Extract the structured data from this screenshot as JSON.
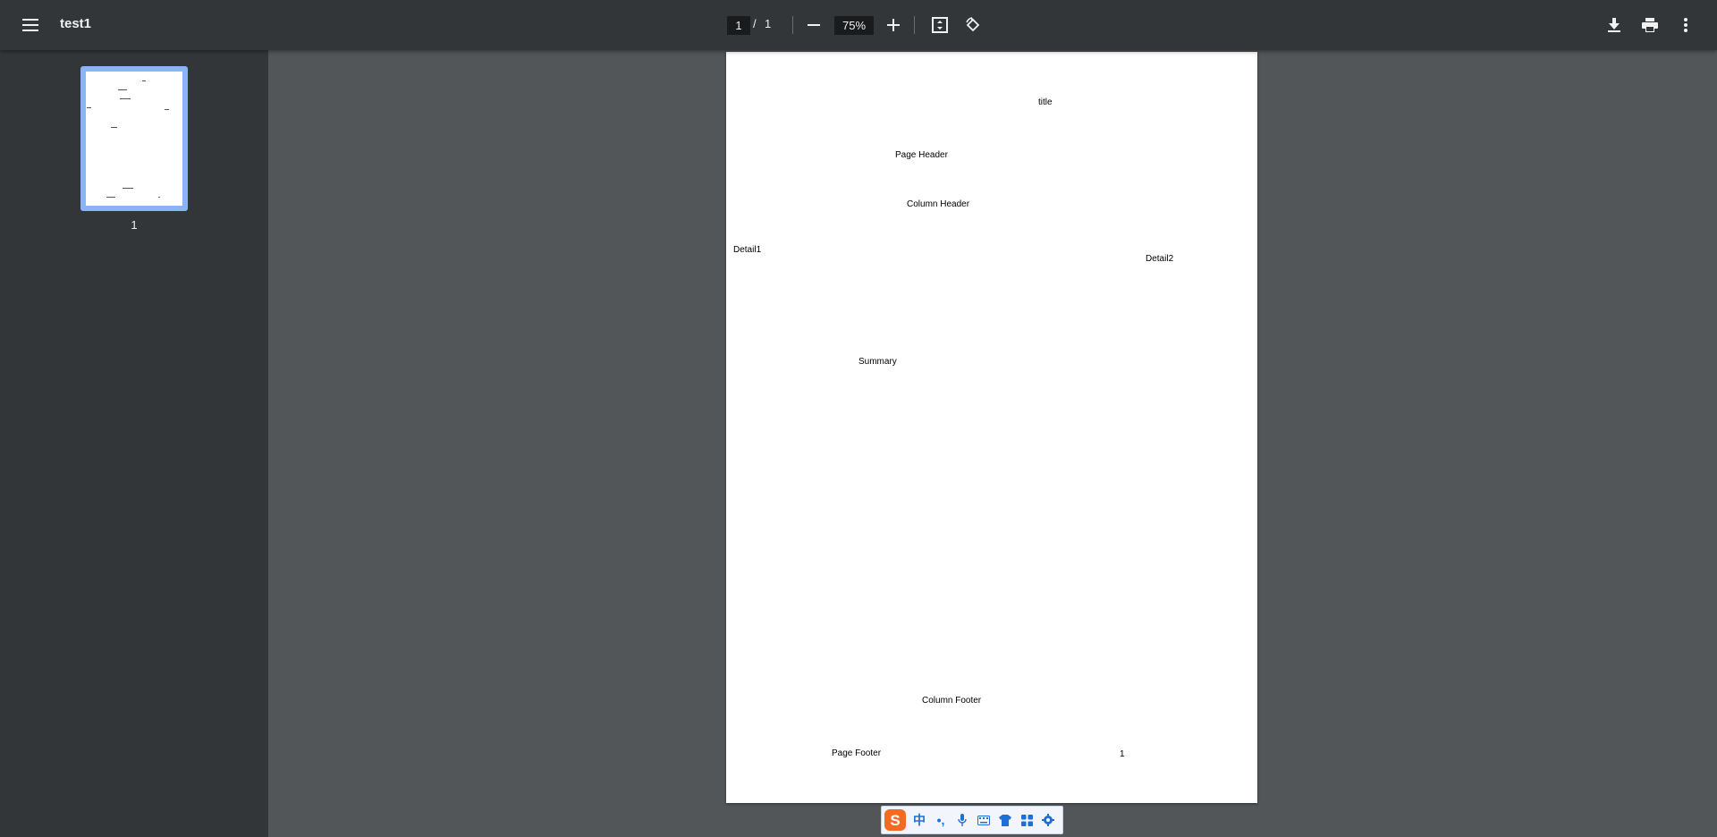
{
  "toolbar": {
    "title": "test1",
    "current_page": "1",
    "page_separator": "/",
    "total_pages": "1",
    "zoom": "75%",
    "icons": [
      "menu-icon",
      "zoom-out-icon",
      "zoom-in-icon",
      "fit-page-icon",
      "rotate-icon",
      "download-icon",
      "print-icon",
      "more-vert-icon"
    ]
  },
  "sidebar": {
    "thumbnails": [
      {
        "label": "1"
      }
    ]
  },
  "page": {
    "title": "title",
    "page_header": "Page Header",
    "column_header": "Column Header",
    "detail1": "Detail1",
    "detail2": "Detail2",
    "summary": "Summary",
    "column_footer": "Column Footer",
    "page_footer": "Page Footer",
    "page_number": "1"
  },
  "ime_bar": {
    "mode": "中",
    "punct": "•,",
    "icons": [
      "sogou-logo-icon",
      "mic-icon",
      "keyboard-icon",
      "skin-icon",
      "toolbox-icon",
      "settings-icon"
    ]
  },
  "colors": {
    "toolbar": "#323639",
    "viewer_bg": "#525659",
    "thumb_highlight": "#8ab4f8",
    "ime_accent": "#1e6fd6"
  }
}
